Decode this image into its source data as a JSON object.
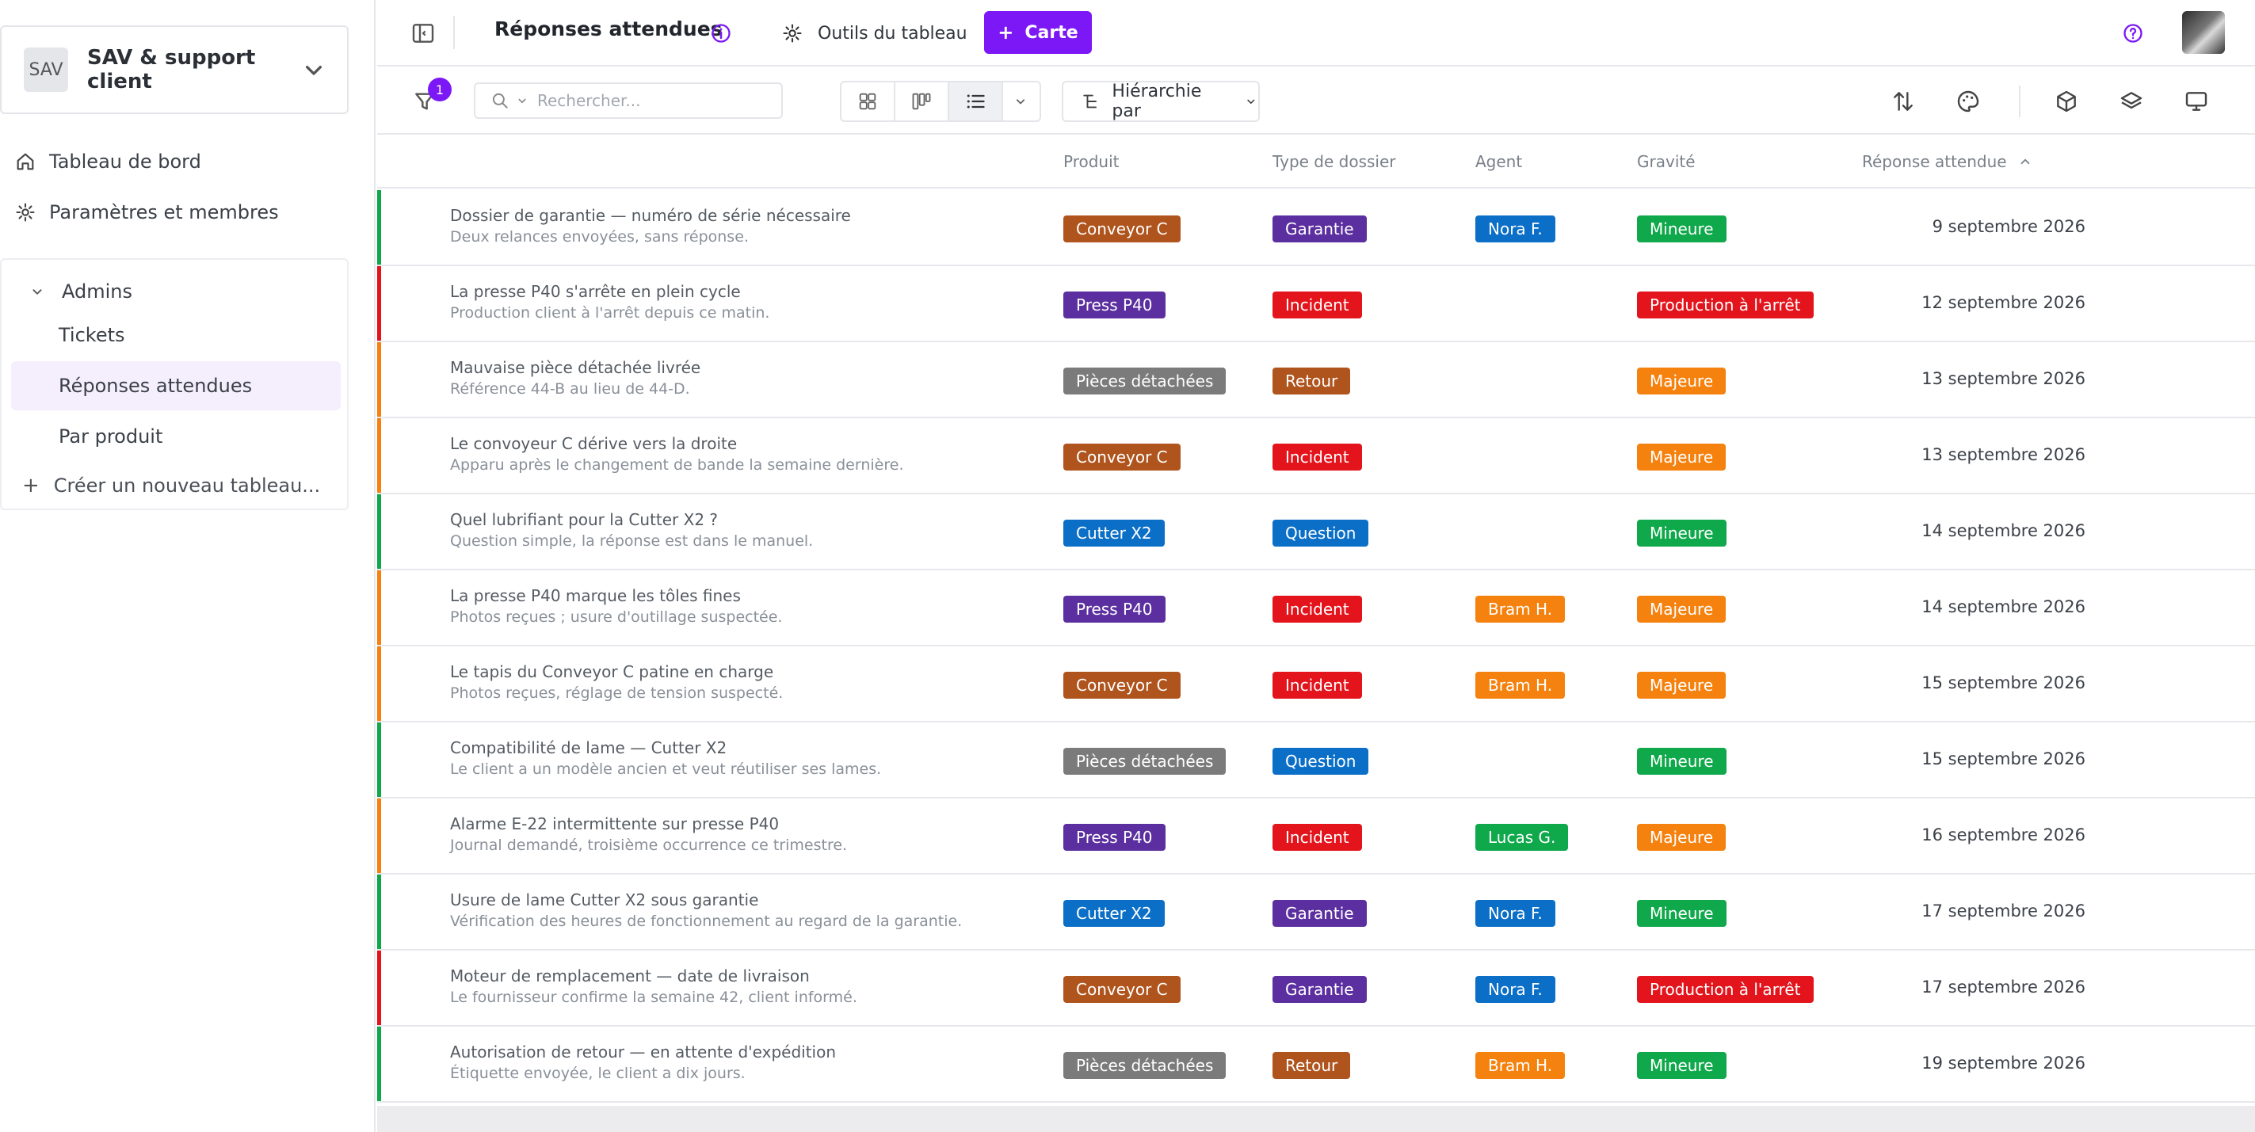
{
  "sidebar": {
    "workspace": {
      "avatar": "SAV",
      "name": "SAV & support client"
    },
    "nav": [
      {
        "label": "Tableau de bord",
        "icon": "home-icon"
      },
      {
        "label": "Paramètres et membres",
        "icon": "gear-icon"
      }
    ],
    "group": {
      "label": "Admins",
      "boards": [
        {
          "label": "Tickets",
          "active": false
        },
        {
          "label": "Réponses attendues",
          "active": true
        },
        {
          "label": "Par produit",
          "active": false
        }
      ],
      "create": "Créer un nouveau tableau..."
    }
  },
  "topbar": {
    "title": "Réponses attendues",
    "tools_label": "Outils du tableau",
    "card_button": "Carte"
  },
  "toolbar": {
    "filter_count": "1",
    "search_placeholder": "Rechercher...",
    "hierarchy_label": "Hiérarchie par"
  },
  "table": {
    "columns": {
      "product": "Produit",
      "type": "Type de dossier",
      "agent": "Agent",
      "severity": "Gravité",
      "due": "Réponse attendue"
    },
    "colors": {
      "green": "#0fa84b",
      "orange": "#f5820f",
      "red": "#e3141c",
      "brown": "#b0541d",
      "purple": "#5b2f9f",
      "blue": "#0b6fc7",
      "gray": "#7b7b7b"
    },
    "rows": [
      {
        "bar": "#0fa84b",
        "title": "Dossier de garantie — numéro de série nécessaire",
        "subtitle": "Deux relances envoyées, sans réponse.",
        "product": {
          "label": "Conveyor C",
          "color": "#b0541d"
        },
        "type": {
          "label": "Garantie",
          "color": "#5b2f9f"
        },
        "agent": {
          "label": "Nora F.",
          "color": "#0b6fc7"
        },
        "severity": {
          "label": "Mineure",
          "color": "#0fa84b"
        },
        "due": "9 septembre 2026"
      },
      {
        "bar": "#e3141c",
        "title": "La presse P40 s'arrête en plein cycle",
        "subtitle": "Production client à l'arrêt depuis ce matin.",
        "product": {
          "label": "Press P40",
          "color": "#5b2f9f"
        },
        "type": {
          "label": "Incident",
          "color": "#e3141c"
        },
        "agent": null,
        "severity": {
          "label": "Production à l'arrêt",
          "color": "#e3141c"
        },
        "due": "12 septembre 2026"
      },
      {
        "bar": "#f5820f",
        "title": "Mauvaise pièce détachée livrée",
        "subtitle": "Référence 44-B au lieu de 44-D.",
        "product": {
          "label": "Pièces détachées",
          "color": "#7b7b7b"
        },
        "type": {
          "label": "Retour",
          "color": "#b0541d"
        },
        "agent": null,
        "severity": {
          "label": "Majeure",
          "color": "#f5820f"
        },
        "due": "13 septembre 2026"
      },
      {
        "bar": "#f5820f",
        "title": "Le convoyeur C dérive vers la droite",
        "subtitle": "Apparu après le changement de bande la semaine dernière.",
        "product": {
          "label": "Conveyor C",
          "color": "#b0541d"
        },
        "type": {
          "label": "Incident",
          "color": "#e3141c"
        },
        "agent": null,
        "severity": {
          "label": "Majeure",
          "color": "#f5820f"
        },
        "due": "13 septembre 2026"
      },
      {
        "bar": "#0fa84b",
        "title": "Quel lubrifiant pour la Cutter X2 ?",
        "subtitle": "Question simple, la réponse est dans le manuel.",
        "product": {
          "label": "Cutter X2",
          "color": "#0b6fc7"
        },
        "type": {
          "label": "Question",
          "color": "#0b6fc7"
        },
        "agent": null,
        "severity": {
          "label": "Mineure",
          "color": "#0fa84b"
        },
        "due": "14 septembre 2026"
      },
      {
        "bar": "#f5820f",
        "title": "La presse P40 marque les tôles fines",
        "subtitle": "Photos reçues ; usure d'outillage suspectée.",
        "product": {
          "label": "Press P40",
          "color": "#5b2f9f"
        },
        "type": {
          "label": "Incident",
          "color": "#e3141c"
        },
        "agent": {
          "label": "Bram H.",
          "color": "#f5820f"
        },
        "severity": {
          "label": "Majeure",
          "color": "#f5820f"
        },
        "due": "14 septembre 2026"
      },
      {
        "bar": "#f5820f",
        "title": "Le tapis du Conveyor C patine en charge",
        "subtitle": "Photos reçues, réglage de tension suspecté.",
        "product": {
          "label": "Conveyor C",
          "color": "#b0541d"
        },
        "type": {
          "label": "Incident",
          "color": "#e3141c"
        },
        "agent": {
          "label": "Bram H.",
          "color": "#f5820f"
        },
        "severity": {
          "label": "Majeure",
          "color": "#f5820f"
        },
        "due": "15 septembre 2026"
      },
      {
        "bar": "#0fa84b",
        "title": "Compatibilité de lame — Cutter X2",
        "subtitle": "Le client a un modèle ancien et veut réutiliser ses lames.",
        "product": {
          "label": "Pièces détachées",
          "color": "#7b7b7b"
        },
        "type": {
          "label": "Question",
          "color": "#0b6fc7"
        },
        "agent": null,
        "severity": {
          "label": "Mineure",
          "color": "#0fa84b"
        },
        "due": "15 septembre 2026"
      },
      {
        "bar": "#f5820f",
        "title": "Alarme E-22 intermittente sur presse P40",
        "subtitle": "Journal demandé, troisième occurrence ce trimestre.",
        "product": {
          "label": "Press P40",
          "color": "#5b2f9f"
        },
        "type": {
          "label": "Incident",
          "color": "#e3141c"
        },
        "agent": {
          "label": "Lucas G.",
          "color": "#0fa84b"
        },
        "severity": {
          "label": "Majeure",
          "color": "#f5820f"
        },
        "due": "16 septembre 2026"
      },
      {
        "bar": "#0fa84b",
        "title": "Usure de lame Cutter X2 sous garantie",
        "subtitle": "Vérification des heures de fonctionnement au regard de la garantie.",
        "product": {
          "label": "Cutter X2",
          "color": "#0b6fc7"
        },
        "type": {
          "label": "Garantie",
          "color": "#5b2f9f"
        },
        "agent": {
          "label": "Nora F.",
          "color": "#0b6fc7"
        },
        "severity": {
          "label": "Mineure",
          "color": "#0fa84b"
        },
        "due": "17 septembre 2026"
      },
      {
        "bar": "#e3141c",
        "title": "Moteur de remplacement — date de livraison",
        "subtitle": "Le fournisseur confirme la semaine 42, client informé.",
        "product": {
          "label": "Conveyor C",
          "color": "#b0541d"
        },
        "type": {
          "label": "Garantie",
          "color": "#5b2f9f"
        },
        "agent": {
          "label": "Nora F.",
          "color": "#0b6fc7"
        },
        "severity": {
          "label": "Production à l'arrêt",
          "color": "#e3141c"
        },
        "due": "17 septembre 2026"
      },
      {
        "bar": "#0fa84b",
        "title": "Autorisation de retour — en attente d'expédition",
        "subtitle": "Étiquette envoyée, le client a dix jours.",
        "product": {
          "label": "Pièces détachées",
          "color": "#7b7b7b"
        },
        "type": {
          "label": "Retour",
          "color": "#b0541d"
        },
        "agent": {
          "label": "Bram H.",
          "color": "#f5820f"
        },
        "severity": {
          "label": "Mineure",
          "color": "#0fa84b"
        },
        "due": "19 septembre 2026"
      }
    ]
  }
}
